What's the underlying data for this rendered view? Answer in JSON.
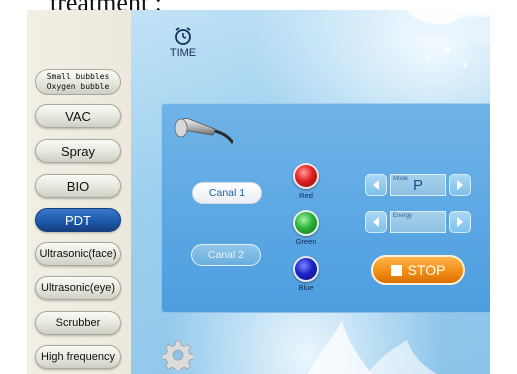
{
  "caption": {
    "text": "treatment :"
  },
  "header": {
    "time_label": "TIME"
  },
  "sidebar": {
    "bubble_button": {
      "line1": "Small bubbles",
      "line2": "Oxygen bubble"
    },
    "items": [
      {
        "label": "VAC"
      },
      {
        "label": "Spray"
      },
      {
        "label": "BIO"
      },
      {
        "label": "PDT"
      },
      {
        "label": "Ultrasonic(face)"
      },
      {
        "label": "Ultrasonic(eye)"
      },
      {
        "label": "Scrubber"
      },
      {
        "label": "High frequency"
      }
    ],
    "active_item": "PDT"
  },
  "panel": {
    "canal1": "Canal 1",
    "canal2": "Canal 2",
    "lights": [
      {
        "label": "Red",
        "color": "#e11f1f"
      },
      {
        "label": "Green",
        "color": "#2bb23a"
      },
      {
        "label": "Blue",
        "color": "#1c22c8"
      }
    ],
    "mode": {
      "label": "Mode",
      "value": "P"
    },
    "energy": {
      "label": "Energy",
      "value": ""
    },
    "stop_label": "STOP"
  },
  "colors": {
    "active": "#1d56a8",
    "stop": "#f08a12",
    "panel": "#4d9ddf"
  }
}
